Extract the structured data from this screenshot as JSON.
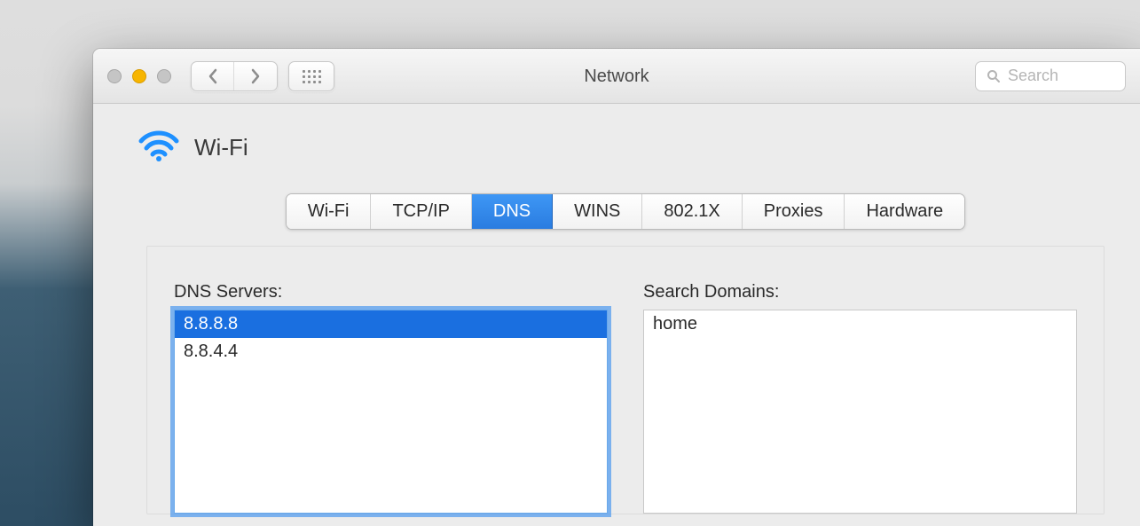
{
  "window": {
    "title": "Network",
    "search_placeholder": "Search"
  },
  "interface": {
    "icon": "wifi-icon",
    "name": "Wi-Fi"
  },
  "tabs": [
    {
      "label": "Wi-Fi",
      "active": false
    },
    {
      "label": "TCP/IP",
      "active": false
    },
    {
      "label": "DNS",
      "active": true
    },
    {
      "label": "WINS",
      "active": false
    },
    {
      "label": "802.1X",
      "active": false
    },
    {
      "label": "Proxies",
      "active": false
    },
    {
      "label": "Hardware",
      "active": false
    }
  ],
  "dns": {
    "servers_label": "DNS Servers:",
    "domains_label": "Search Domains:",
    "servers": [
      {
        "value": "8.8.8.8",
        "selected": true
      },
      {
        "value": "8.8.4.4",
        "selected": false
      }
    ],
    "domains": [
      {
        "value": "home",
        "selected": false
      }
    ]
  }
}
